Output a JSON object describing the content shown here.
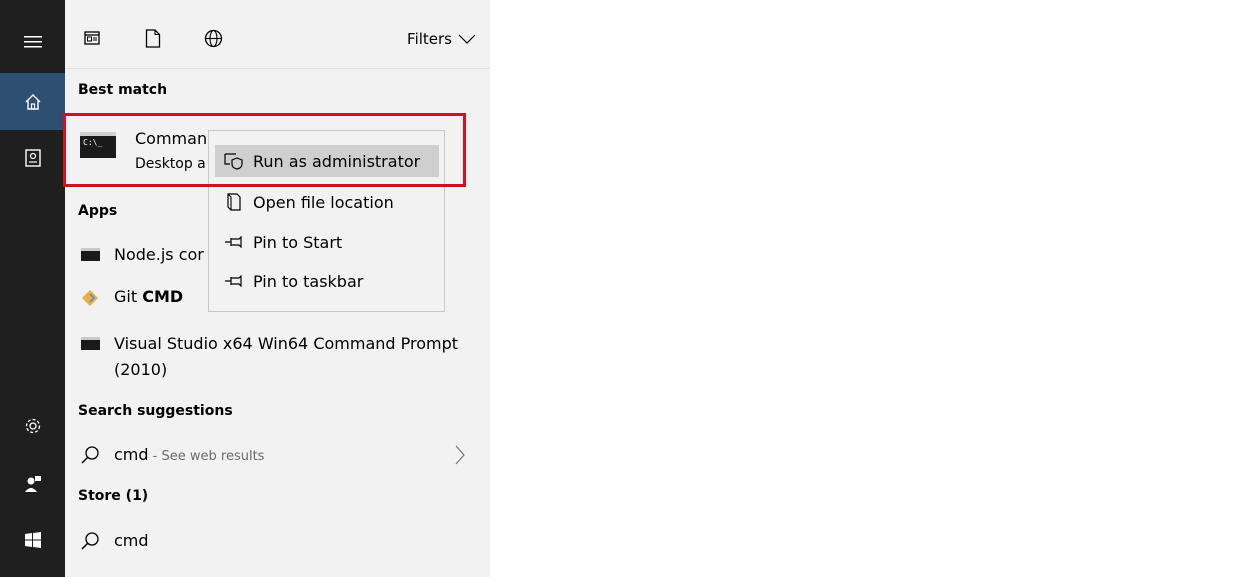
{
  "filters_label": "Filters",
  "best_match": {
    "heading": "Best match",
    "title": "Comman",
    "subtitle": "Desktop a"
  },
  "context_menu": {
    "items": [
      {
        "label": "Run as administrator",
        "icon": "shield-run-icon"
      },
      {
        "label": "Open file location",
        "icon": "folder-location-icon"
      },
      {
        "label": "Pin to Start",
        "icon": "pin-icon"
      },
      {
        "label": "Pin to taskbar",
        "icon": "pin-icon"
      }
    ]
  },
  "apps": {
    "heading": "Apps",
    "items": [
      {
        "label": "Node.js cor",
        "icon": "console-icon"
      },
      {
        "label_prefix": "Git ",
        "label_bold": "CMD",
        "icon": "git-icon"
      },
      {
        "label_line1": "Visual Studio x64 Win64 Command Prompt",
        "label_line2": "(2010)",
        "icon": "console-icon"
      }
    ]
  },
  "search_suggestions": {
    "heading": "Search suggestions",
    "query": "cmd",
    "hint": " - See web results"
  },
  "store": {
    "heading": "Store (1)",
    "query": "cmd"
  },
  "colors": {
    "rail": "#1f1f1f",
    "rail_active": "#2d4f71",
    "panel": "#f2f2f2",
    "highlight_box": "#d0121b"
  }
}
